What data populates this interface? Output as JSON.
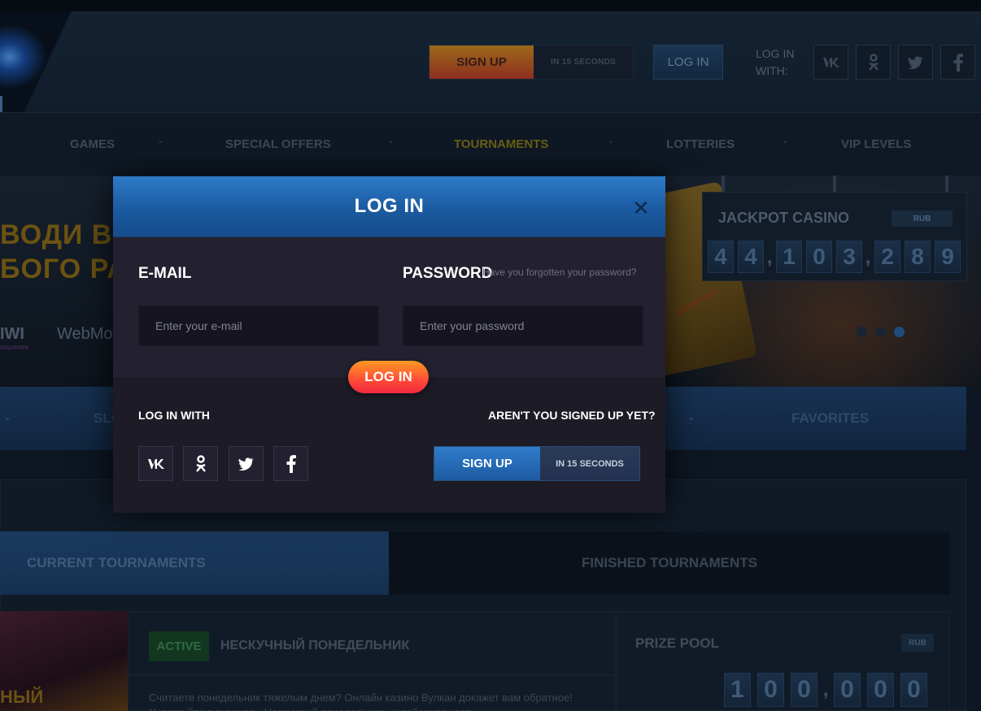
{
  "header": {
    "signup_label": "SIGN UP",
    "signup_sub": "IN 15 SECONDS",
    "login_label": "LOG IN",
    "login_with_label": "LOG IN WITH:",
    "social": [
      {
        "icon": "vk-icon",
        "glyph": "vk"
      },
      {
        "icon": "odnoklassniki-icon",
        "glyph": "ok"
      },
      {
        "icon": "twitter-icon",
        "glyph": "tw"
      },
      {
        "icon": "facebook-icon",
        "glyph": "f"
      }
    ]
  },
  "nav": {
    "items": [
      "GAMES",
      "SPECIAL OFFERS",
      "TOURNAMENTS",
      "LOTTERIES",
      "VIP LEVELS"
    ],
    "separator": "-",
    "active": "TOURNAMENTS"
  },
  "banner": {
    "line1": "ВОДИ В",
    "line2": "БОГО РА",
    "pay1": "IWI",
    "pay1_sub": "кошелек",
    "pay2": "WebMo",
    "card_label": "MasterCard",
    "jackpot": {
      "title": "JACKPOT CASINO",
      "currency": "RUB",
      "groups": [
        "44",
        "103",
        "289"
      ]
    }
  },
  "categories": {
    "items": [
      "SLO",
      "FAVORITES"
    ],
    "separator": "-"
  },
  "tournaments": {
    "tab_current": "CURRENT TOURNAMENTS",
    "tab_finished": "FINISHED TOURNAMENTS",
    "badge": "ACTIVE",
    "title": "НЕСКУЧНЫЙ ПОНЕДЕЛЬНИК",
    "description": "Считаете понедельник тяжелым днем? Онлайн казино Вулкан докажет вам обратное! Участвуйте в турнире «Нескучный понедельник» и заберите часть",
    "image_text": "НЫЙ",
    "prize_pool_label": "PRIZE POOL",
    "prize_currency": "RUB",
    "prize_groups": [
      "100",
      "000"
    ]
  },
  "modal": {
    "title": "LOG IN",
    "email_label": "E-MAIL",
    "email_placeholder": "Enter your e-mail",
    "password_label": "PASSWORD",
    "forgot_label": "Have you forgotten your password?",
    "password_placeholder": "Enter your password",
    "login_button": "LOG IN",
    "login_with_label": "LOG IN WITH",
    "not_signed_label": "AREN'T YOU SIGNED UP YET?",
    "signup_label": "SIGN UP",
    "signup_sub": "IN 15 SECONDS",
    "close_glyph": "✕"
  },
  "colors": {
    "modal_header": "#2d7ac8",
    "login_button": "#ff5a30",
    "signup_button": "#2f7ccb",
    "active_nav": "#6b5f13"
  }
}
